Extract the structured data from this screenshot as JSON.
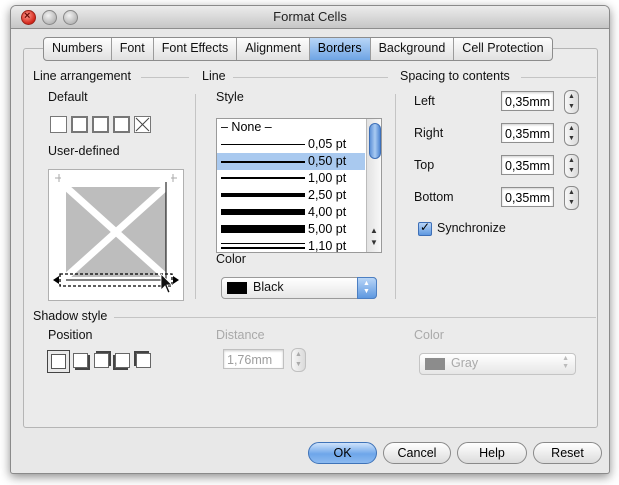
{
  "window": {
    "title": "Format Cells"
  },
  "tabs": [
    "Numbers",
    "Font",
    "Font Effects",
    "Alignment",
    "Borders",
    "Background",
    "Cell Protection"
  ],
  "active_tab": "Borders",
  "line_arrangement": {
    "label": "Line arrangement",
    "default_label": "Default",
    "user_defined_label": "User-defined"
  },
  "line": {
    "label": "Line",
    "style_label": "Style",
    "styles": [
      {
        "label": "– None –",
        "thickness": 0
      },
      {
        "label": "0,05 pt",
        "thickness": 1
      },
      {
        "label": "0,50 pt",
        "thickness": 2,
        "selected": true
      },
      {
        "label": "1,00 pt",
        "thickness": 2
      },
      {
        "label": "2,50 pt",
        "thickness": 4
      },
      {
        "label": "4,00 pt",
        "thickness": 6
      },
      {
        "label": "5,00 pt",
        "thickness": 8
      },
      {
        "label": "1,10 pt",
        "thickness": 3
      }
    ],
    "color_label": "Color",
    "color_value": "Black",
    "color_swatch": "#000000"
  },
  "spacing": {
    "label": "Spacing to contents",
    "left_label": "Left",
    "left_value": "0,35mm",
    "right_label": "Right",
    "right_value": "0,35mm",
    "top_label": "Top",
    "top_value": "0,35mm",
    "bottom_label": "Bottom",
    "bottom_value": "0,35mm",
    "synchronize_label": "Synchronize",
    "synchronize_checked": true
  },
  "shadow": {
    "label": "Shadow style",
    "position_label": "Position",
    "distance_label": "Distance",
    "distance_value": "1,76mm",
    "color_label": "Color",
    "color_value": "Gray",
    "color_swatch": "#8c8c8c"
  },
  "buttons": {
    "ok": "OK",
    "cancel": "Cancel",
    "help": "Help",
    "reset": "Reset"
  }
}
